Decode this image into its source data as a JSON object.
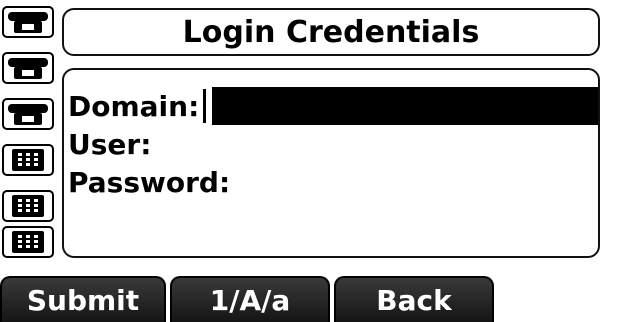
{
  "screen": {
    "title": "Login Credentials"
  },
  "form": {
    "domain_label": "Domain:",
    "domain_value": "",
    "user_label": "User:",
    "password_label": "Password:"
  },
  "linekeys": [
    "handset-icon",
    "handset-icon",
    "handset-icon",
    "keypad-icon",
    "keypad-icon",
    "keypad-icon"
  ],
  "softkeys": {
    "submit": "Submit",
    "mode": "1/A/a",
    "back": "Back"
  },
  "colors": {
    "background": "#ffffff",
    "text": "#000000",
    "softkey_bg": "#222222",
    "softkey_text": "#ffffff",
    "highlight": "#000000"
  }
}
